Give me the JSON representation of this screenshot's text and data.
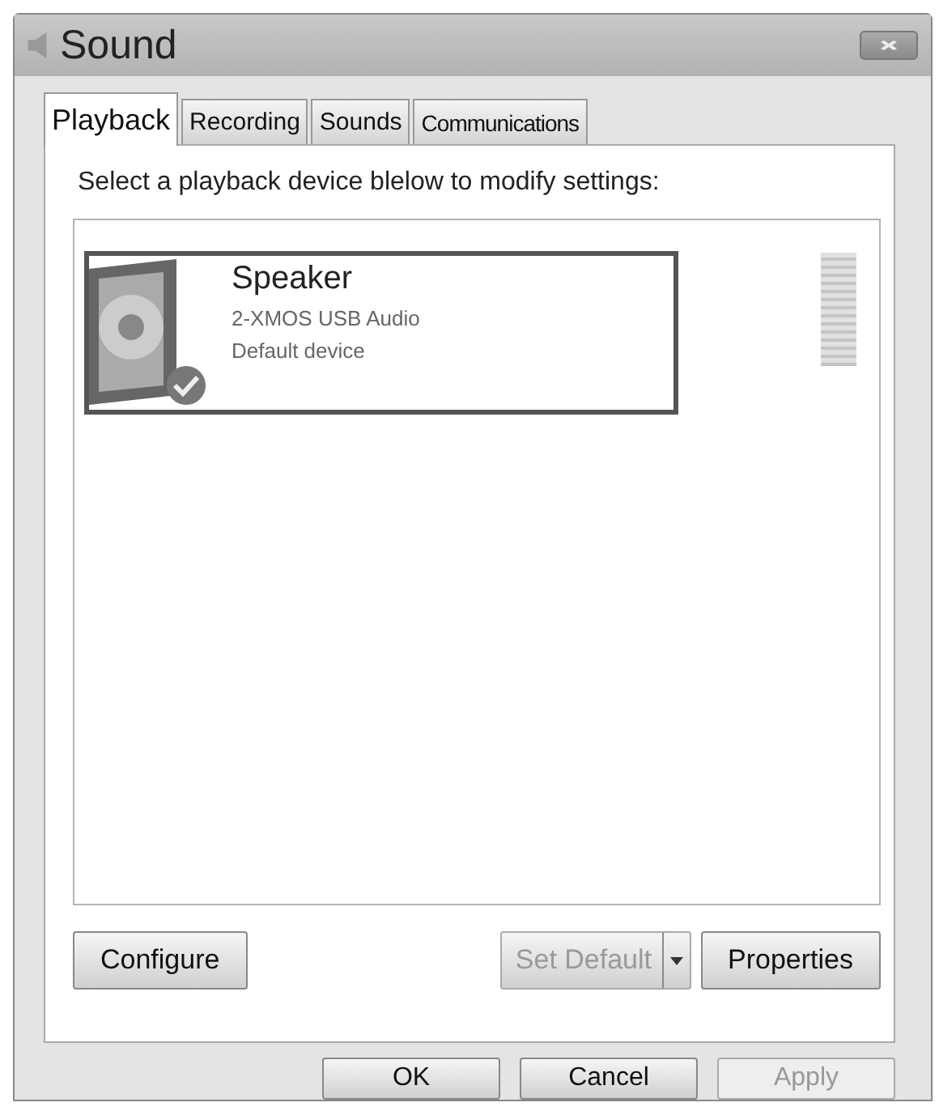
{
  "window": {
    "title": "Sound"
  },
  "tabs": [
    {
      "label": "Playback",
      "selected": true
    },
    {
      "label": "Recording",
      "selected": false
    },
    {
      "label": "Sounds",
      "selected": false
    },
    {
      "label": "Communications",
      "selected": false
    }
  ],
  "instruction": "Select a playback device blelow to modify settings:",
  "devices": [
    {
      "name": "Speaker",
      "detail": "2-XMOS USB Audio",
      "status": "Default device",
      "selected": true,
      "default": true,
      "level": 0
    }
  ],
  "device_buttons": [
    {
      "label": "Configure",
      "disabled": false,
      "kind": "plain"
    },
    {
      "label": "Set Default",
      "disabled": true,
      "kind": "split"
    },
    {
      "label": "Properties",
      "disabled": false,
      "kind": "plain"
    }
  ],
  "dialog_buttons": [
    {
      "label": "OK",
      "disabled": false
    },
    {
      "label": "Cancel",
      "disabled": false
    },
    {
      "label": "Apply",
      "disabled": true
    }
  ]
}
